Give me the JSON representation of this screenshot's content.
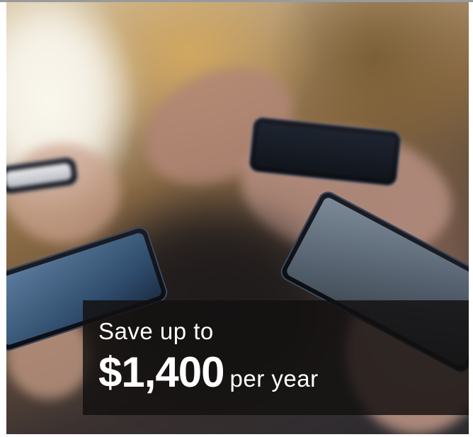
{
  "banner": {
    "line1": "Save up to",
    "amount": "$1,400",
    "suffix": "per year"
  },
  "colors": {
    "banner_background": "#121010",
    "banner_text": "#ffffff",
    "page_background": "#ffffff"
  }
}
